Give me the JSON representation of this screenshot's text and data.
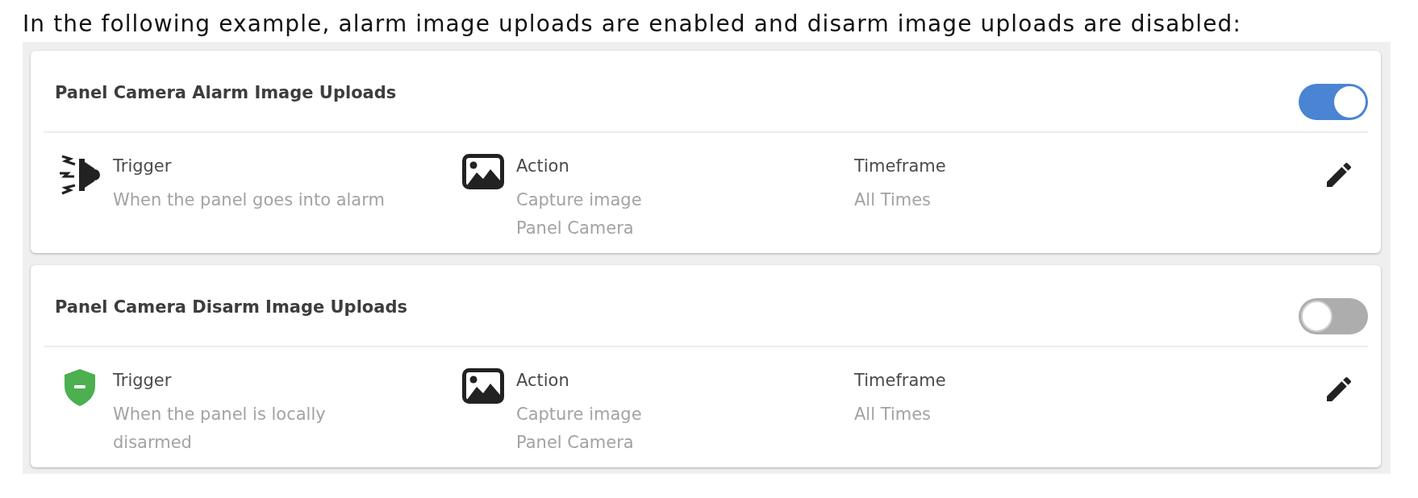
{
  "intro": "In the following example, alarm image uploads are enabled and disarm image uploads are disabled:",
  "rules": [
    {
      "title": "Panel Camera Alarm Image Uploads",
      "on": true,
      "fields": [
        {
          "kind": "siren",
          "label": "Trigger",
          "lines": [
            "When the panel goes into alarm"
          ]
        },
        {
          "kind": "image",
          "label": "Action",
          "lines": [
            "Capture image",
            "Panel Camera"
          ]
        },
        {
          "kind": "plain",
          "label": "Timeframe",
          "lines": [
            "All Times"
          ]
        }
      ]
    },
    {
      "title": "Panel Camera Disarm Image Uploads",
      "on": false,
      "fields": [
        {
          "kind": "shield",
          "label": "Trigger",
          "lines": [
            "When the panel is locally disarmed"
          ]
        },
        {
          "kind": "image",
          "label": "Action",
          "lines": [
            "Capture image",
            "Panel Camera"
          ]
        },
        {
          "kind": "plain",
          "label": "Timeframe",
          "lines": [
            "All Times"
          ]
        }
      ]
    }
  ]
}
